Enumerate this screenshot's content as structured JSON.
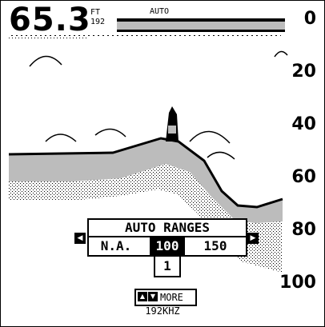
{
  "header": {
    "depth_value": "65.3",
    "depth_unit": "FT",
    "frequency_small": "192",
    "mode": "AUTO"
  },
  "scale": {
    "labels": [
      "0",
      "20",
      "40",
      "60",
      "80",
      "100"
    ]
  },
  "dialog": {
    "title": "AUTO RANGES",
    "options": [
      "N.A.",
      "100",
      "150"
    ],
    "selected_option": "100",
    "sub_value": "1"
  },
  "footer": {
    "more_label": "MORE",
    "frequency": "192KHZ"
  }
}
